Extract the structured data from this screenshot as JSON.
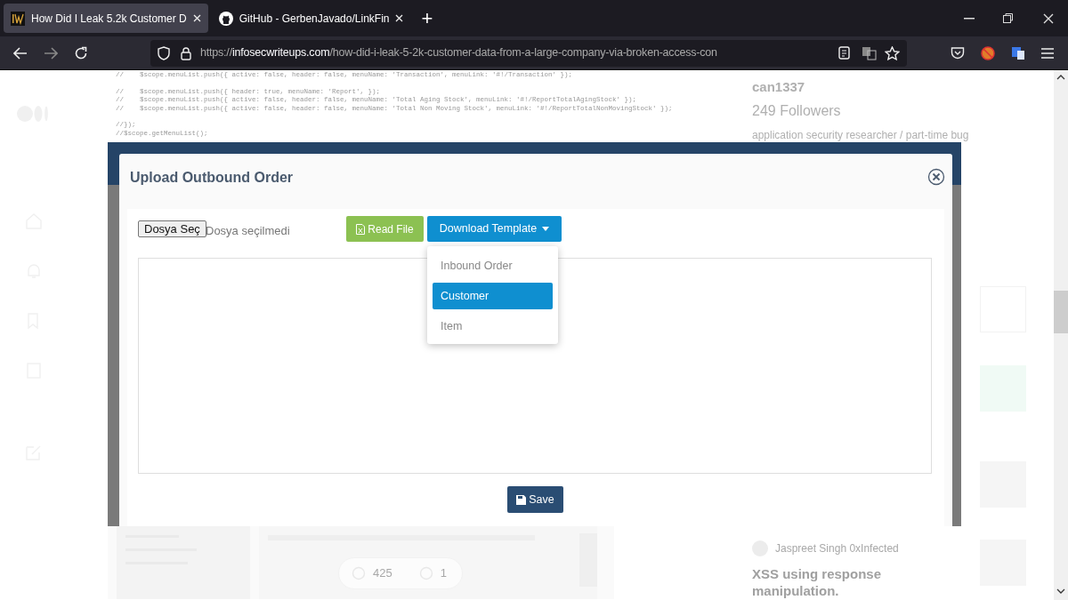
{
  "browser": {
    "tabs": [
      {
        "title": "How Did I Leak 5.2k Customer D",
        "selected": true,
        "kind": "site"
      },
      {
        "title": "GitHub - GerbenJavado/LinkFin",
        "selected": false,
        "kind": "github"
      }
    ],
    "url": {
      "scheme": "https://",
      "host": "infosecwriteups.com",
      "path": "/how-did-i-leak-5-2k-customer-data-from-a-large-company-via-broken-access-con"
    }
  },
  "new_tab_label": "+",
  "article": {
    "code_blocks": [
      [
        "//    $scope.menuList.push({ active: false, header: false, menuName: 'Transaction', menuLink: '#!/Transaction' });"
      ],
      [
        "//    $scope.menuList.push({ header: true, menuName: 'Report', });",
        "//    $scope.menuList.push({ active: false, header: false, menuName: 'Total Aging Stock', menuLink: '#!/ReportTotalAgingStock' });",
        "//    $scope.menuList.push({ active: false, header: false, menuName: 'Total Non Moving Stock', menuLink: '#!/ReportTotalNonMovingStock' });"
      ],
      [
        "//});",
        "//$scope.getMenuList();"
      ]
    ],
    "claps": "425",
    "comments": "1"
  },
  "sidebar": {
    "author": "can1337",
    "followers": "249 Followers",
    "bio": "application security researcher / part-time bug",
    "recommended_author": "Jaspreet Singh 0xInfected",
    "recommended_title": "XSS using response manipulation."
  },
  "modal": {
    "title": "Upload Outbound Order",
    "file_button": "Dosya Seç",
    "file_status": "Dosya seçilmedi",
    "read_button": "Read File",
    "download_button": "Download Template",
    "menu_open": true,
    "menu": [
      {
        "label": "Inbound Order",
        "selected": false
      },
      {
        "label": "Customer",
        "selected": true
      },
      {
        "label": "Item",
        "selected": false
      }
    ],
    "save_button": "Save"
  }
}
